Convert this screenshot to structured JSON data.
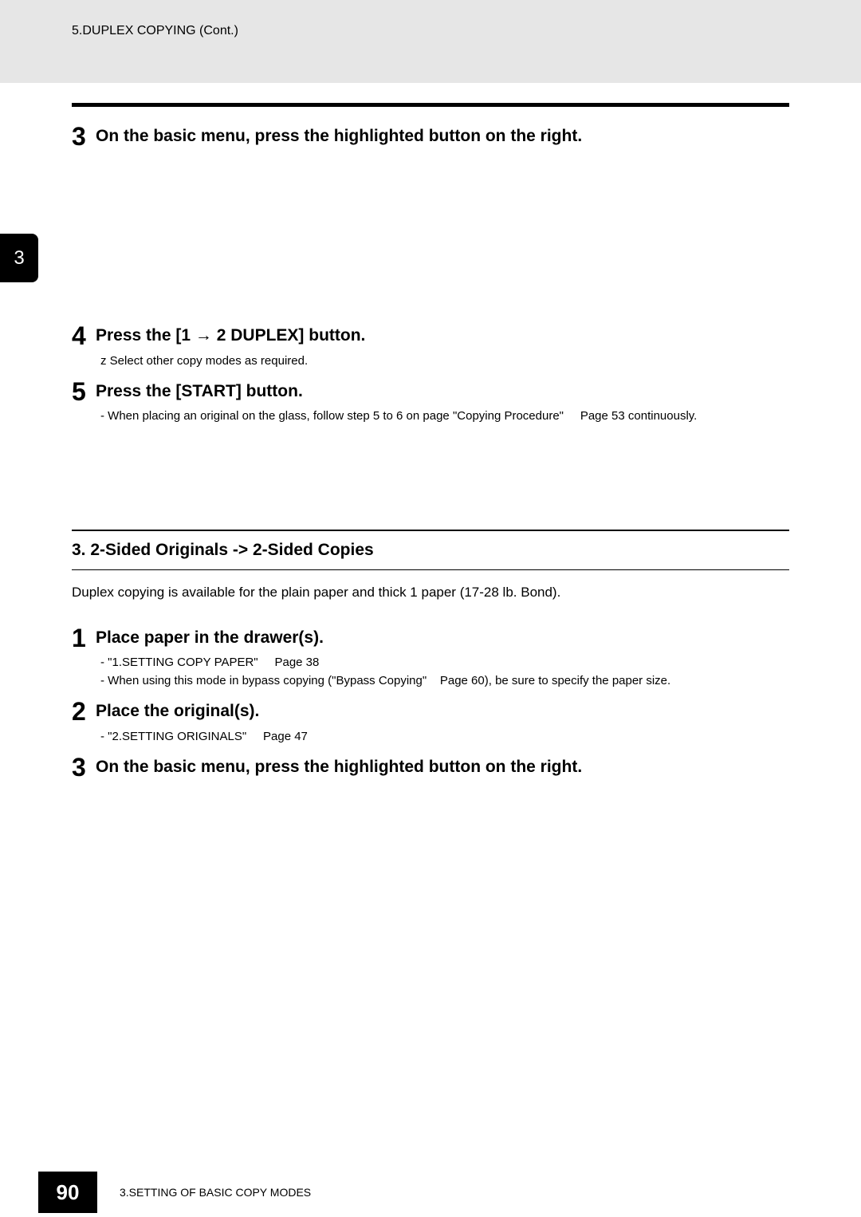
{
  "header": {
    "title": "5.DUPLEX COPYING (Cont.)"
  },
  "tab": {
    "number": "3"
  },
  "stepsTop": [
    {
      "num": "3",
      "title": "On the basic menu, press the highlighted button on the right.",
      "notes": []
    },
    {
      "num": "4",
      "title": "Press the [1 → 2 DUPLEX] button.",
      "notes": [
        "z Select other copy modes as required."
      ]
    },
    {
      "num": "5",
      "title": "Press the [START] button.",
      "notes": [
        "- When placing an original on the glass, follow step 5 to 6 on page \"Copying Procedure\"     Page 53 continuously."
      ]
    }
  ],
  "section": {
    "heading": "3. 2-Sided Originals -> 2-Sided Copies",
    "desc": "Duplex copying is available for the plain paper and thick 1 paper (17-28 lb. Bond)."
  },
  "stepsBottom": [
    {
      "num": "1",
      "title": "Place paper in the drawer(s).",
      "notes": [
        "- \"1.SETTING COPY PAPER\"     Page 38",
        "- When using this mode in bypass copying (\"Bypass Copying\"    Page 60), be sure to specify the paper size."
      ]
    },
    {
      "num": "2",
      "title": "Place the original(s).",
      "notes": [
        "- \"2.SETTING ORIGINALS\"     Page 47"
      ]
    },
    {
      "num": "3",
      "title": "On the basic menu, press the highlighted button on the right.",
      "notes": []
    }
  ],
  "footer": {
    "page": "90",
    "chapter": "3.SETTING OF BASIC COPY MODES"
  }
}
